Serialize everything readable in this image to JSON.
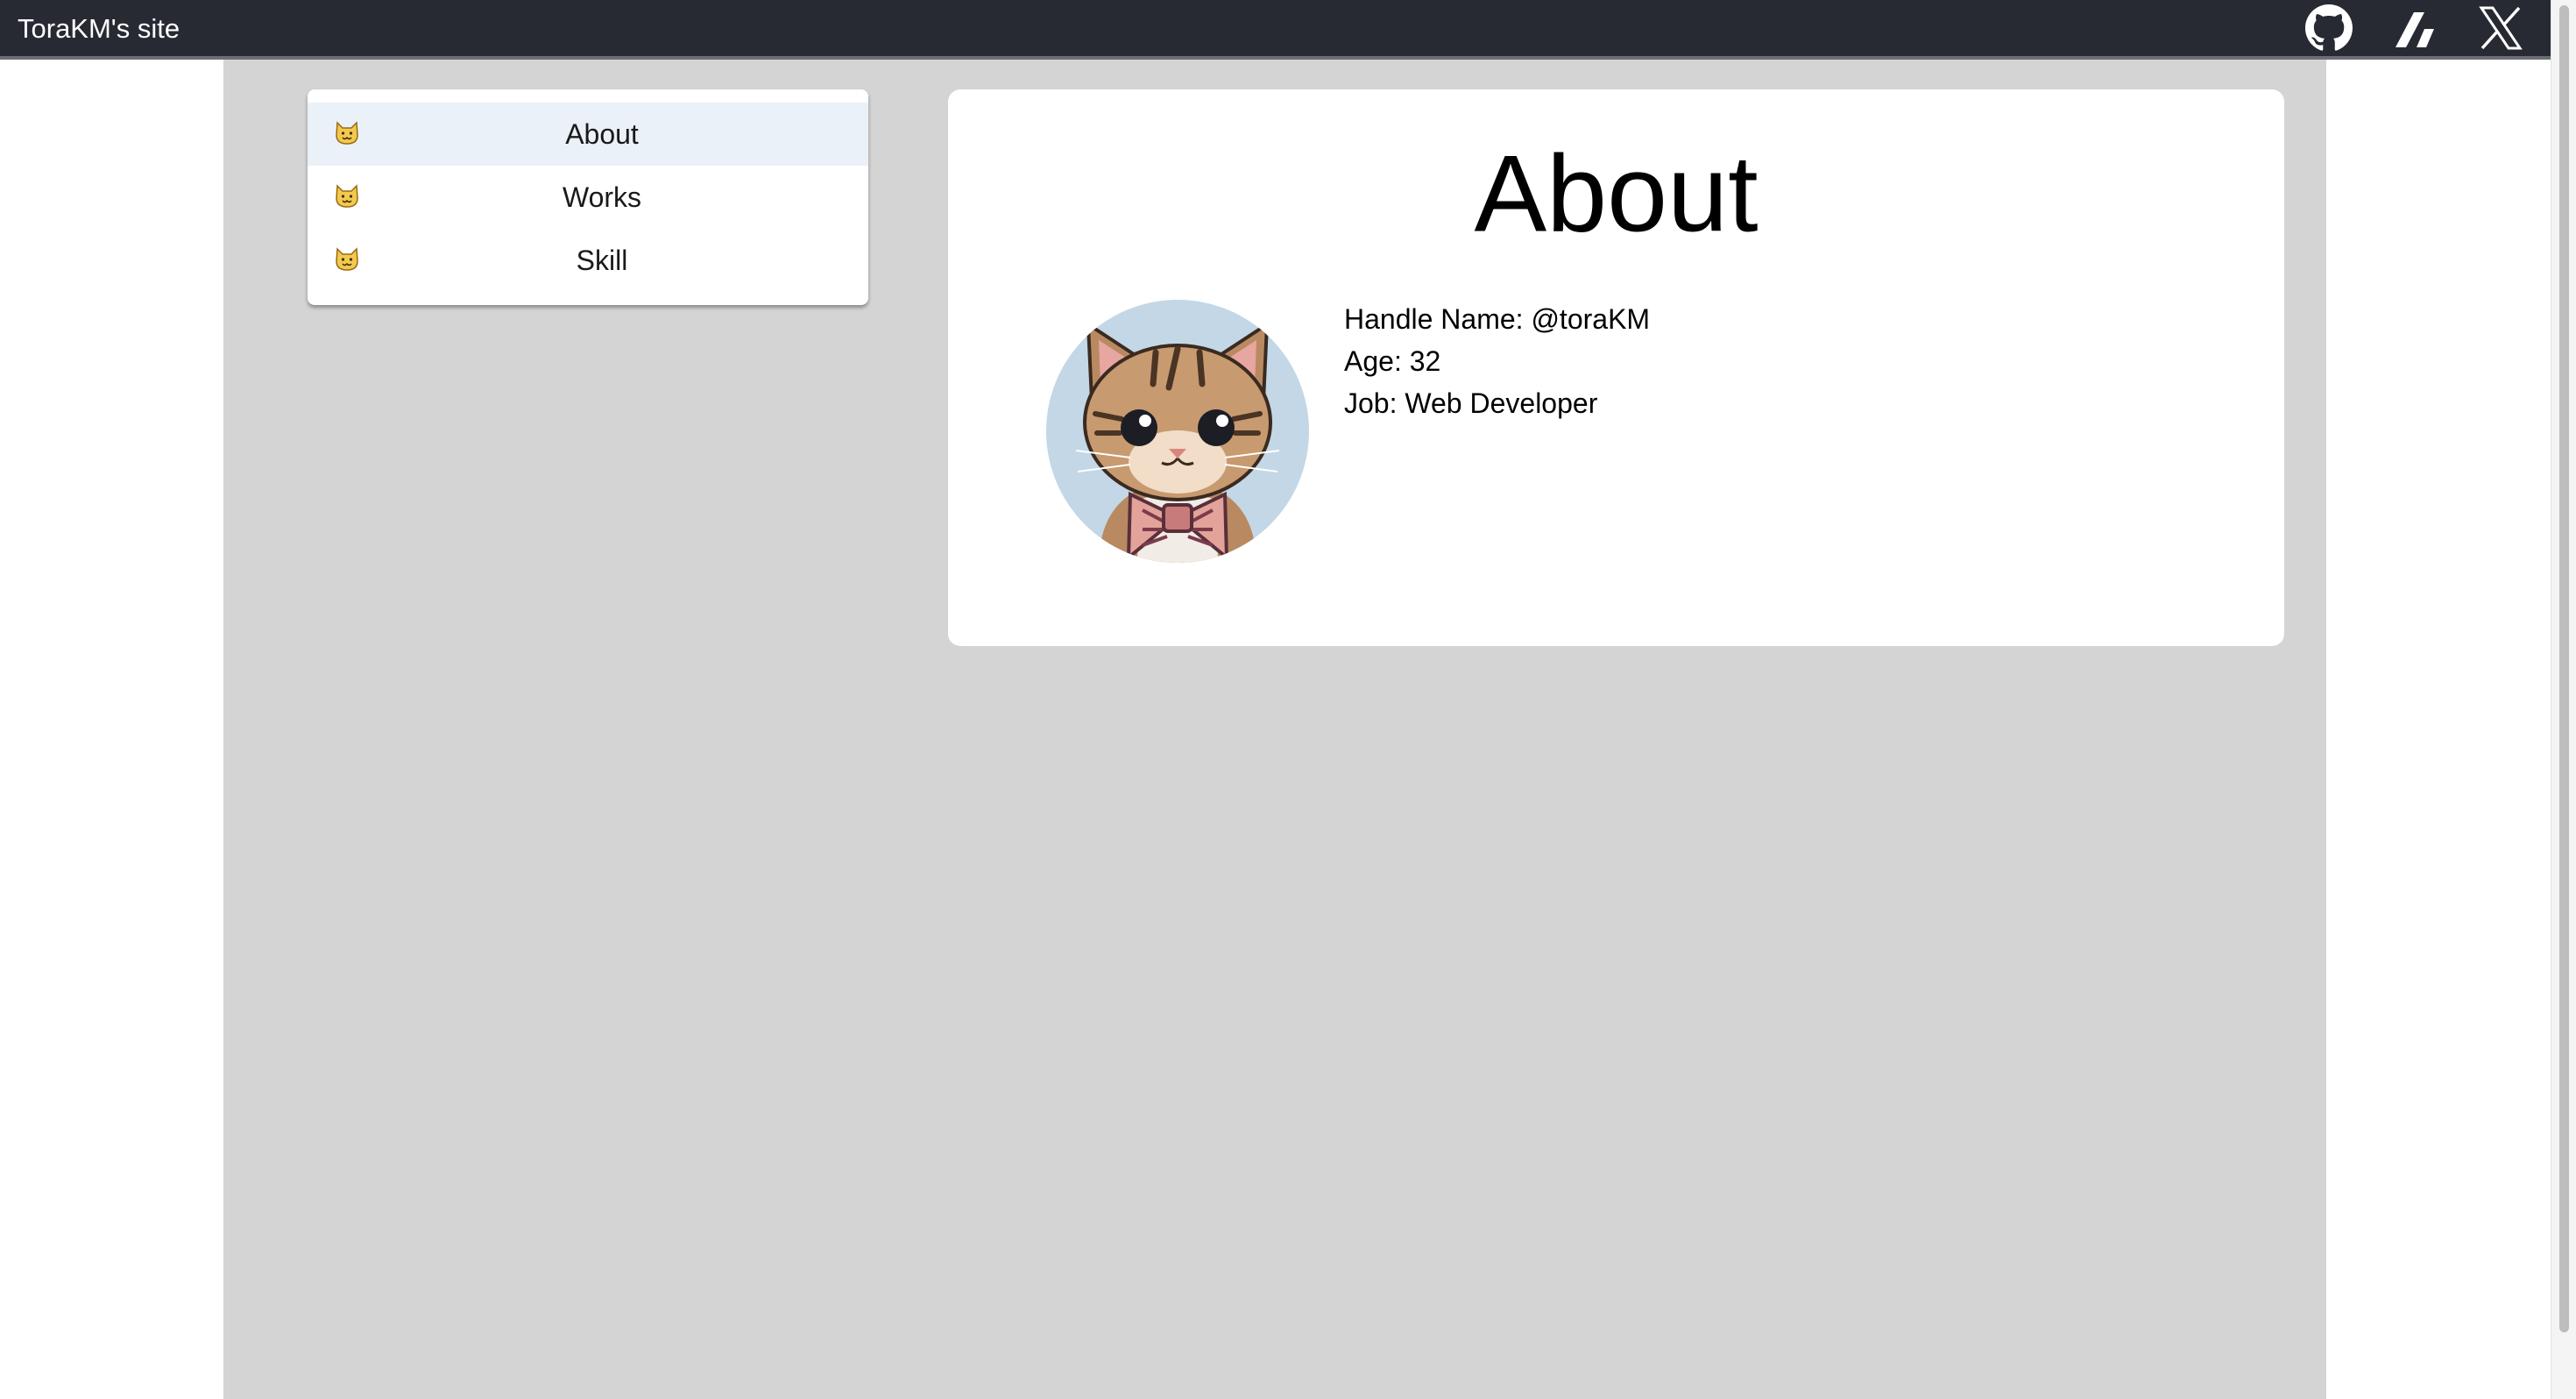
{
  "header": {
    "site_title": "ToraKM's site",
    "icons": [
      {
        "name": "github-icon"
      },
      {
        "name": "zenn-icon"
      },
      {
        "name": "x-icon"
      }
    ]
  },
  "sidebar": {
    "items": [
      {
        "label": "About",
        "icon": "cat-face-icon",
        "active": true
      },
      {
        "label": "Works",
        "icon": "cat-face-icon",
        "active": false
      },
      {
        "label": "Skill",
        "icon": "cat-face-icon",
        "active": false
      }
    ]
  },
  "main": {
    "title": "About",
    "avatar": "pixel-art kitten with bow tie",
    "profile": {
      "handle": "Handle Name: @toraKM",
      "age": "Age: 32",
      "job": "Job: Web Developer"
    }
  },
  "colors": {
    "topbar": "#272a33",
    "page_background": "#d4d4d4",
    "card": "#ffffff",
    "active_menu": "#ebf1f9",
    "avatar_background": "#c3d7e6"
  }
}
